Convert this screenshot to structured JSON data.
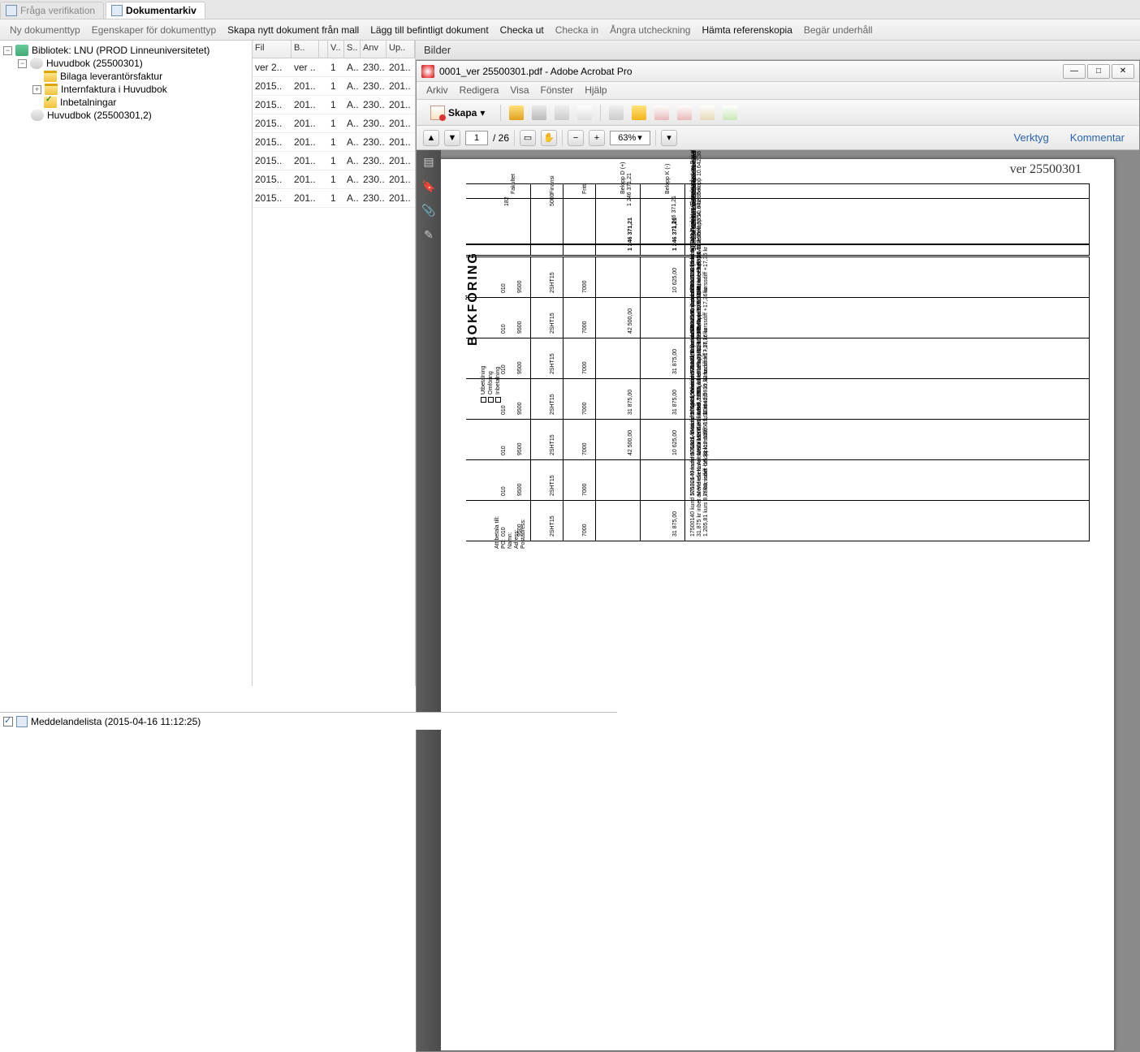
{
  "tabs": [
    {
      "label": "Fråga verifikation",
      "active": false
    },
    {
      "label": "Dokumentarkiv",
      "active": true
    }
  ],
  "toolbar": [
    {
      "label": "Ny dokumenttyp",
      "dark": false
    },
    {
      "label": "Egenskaper för dokumenttyp",
      "dark": false
    },
    {
      "label": "Skapa nytt dokument från mall",
      "dark": true
    },
    {
      "label": "Lägg till befintligt dokument",
      "dark": true
    },
    {
      "label": "Checka ut",
      "dark": true
    },
    {
      "label": "Checka in",
      "dark": false
    },
    {
      "label": "Ångra utcheckning",
      "dark": false
    },
    {
      "label": "Hämta referenskopia",
      "dark": true
    },
    {
      "label": "Begär underhåll",
      "dark": false
    }
  ],
  "tree": {
    "root": "Bibliotek: LNU (PROD Linneuniversitetet)",
    "n1": "Huvudbok (25500301)",
    "n1a": "Bilaga leverantörsfaktur",
    "n1b": "Internfaktura i Huvudbok",
    "n1c": "Inbetalningar",
    "n2": "Huvudbok (25500301,2)"
  },
  "grid": {
    "headers": [
      "Fil",
      "B..",
      "",
      "V..",
      "S..",
      "Anv",
      "Up.."
    ],
    "rows": [
      [
        "ver 2..",
        "ver ..",
        "1",
        "A..",
        "230..",
        "201.."
      ],
      [
        "2015..",
        "201..",
        "1",
        "A..",
        "230..",
        "201.."
      ],
      [
        "2015..",
        "201..",
        "1",
        "A..",
        "230..",
        "201.."
      ],
      [
        "2015..",
        "201..",
        "1",
        "A..",
        "230..",
        "201.."
      ],
      [
        "2015..",
        "201..",
        "1",
        "A..",
        "230..",
        "201.."
      ],
      [
        "2015..",
        "201..",
        "1",
        "A..",
        "230..",
        "201.."
      ],
      [
        "2015..",
        "201..",
        "1",
        "A..",
        "230..",
        "201.."
      ],
      [
        "2015..",
        "201..",
        "1",
        "A..",
        "230..",
        "201.."
      ]
    ]
  },
  "right": {
    "panel_title": "Bilder",
    "doc_title": "0001_ver 25500301.pdf - Adobe Acrobat Pro",
    "menu": [
      "Arkiv",
      "Redigera",
      "Visa",
      "Fönster",
      "Hjälp"
    ],
    "skapa": "Skapa",
    "page": "1",
    "page_of": "/ 26",
    "zoom": "63%",
    "links": [
      "Verktyg",
      "Kommentar"
    ],
    "handwritten": "ver 25500301"
  },
  "doc": {
    "bokforing": "BOKFÖRING",
    "checks": [
      "Utbetalning",
      "Omföring",
      "Inbetalning"
    ],
    "att_betala": "Att betala till:",
    "fields": [
      "PG:",
      "Namn:",
      "Adress:",
      "Postadress:"
    ],
    "hdr": {
      "fak": "Fakultet",
      "fin": "Finansi",
      "fritt": "Fritt",
      "bd": "Belopp D (+)",
      "bk": "Belopp K (-)",
      "txt": "Text i bokföringen"
    },
    "top_rows": [
      {
        "a": "182",
        "b": "5000",
        "d": "1 246 371,21",
        "k": "",
        "t": "Inbetalning 2015-04-13, PG 50916-8"
      },
      {
        "a": "",
        "b": "",
        "d": "",
        "k": "",
        "t": "European Commission, ref 1584005574 PIEF-GA-2013-622888-"
      },
      {
        "a": "",
        "b": "",
        "d": "",
        "k": "1 246 371,21",
        "t": "PROM LNU Dr Jarone Pinhassi Pre-financing, inbet EUR"
      },
      {
        "a": "",
        "b": "",
        "d": "",
        "k": "",
        "t": "134.128,02 kurs 9,29240"
      }
    ],
    "sum": {
      "d": "1 246 371,21",
      "k": "1 246 371,21",
      "t": "Summa Nordea"
    },
    "rows": [
      {
        "a": "010",
        "b": "9500",
        "c": "2SHT15",
        "d": "7000",
        "e": "",
        "k": "10 625,00",
        "t1": "17500150 kund 501323 Bajraktari Flamur, inbet av Bajraktari",
        "t2": "Flamur, EUR 1.140, kurs 9,3354, inbet belopp 10.642,36 kr",
        "t3": "kurssdiff +17,36 kr"
      },
      {
        "a": "010",
        "b": "9500",
        "c": "2SHT15",
        "d": "7000",
        "e": "42 500,00",
        "k": "",
        "t1": "17500150 kund 501323 Bajraktari Flamur, inbet av Bajraktari",
        "t2": "Flamur, EUR 1.140, kurs 9,3354, inbet belopp 10.642,36 kr",
        "t3": "kurssdiff +17,36 kr"
      },
      {
        "a": "010",
        "b": "9500",
        "c": "2SHT15",
        "d": "7000",
        "e": "",
        "k": "31 875,00",
        "t1": "17500150 kund 501323 Bajraktari Flamur, inbet av Bajraktari",
        "t2": "Flamur, EUR 1.140, kurs 9,3354, inbet belopp 10.642,36 kr",
        "t3": "kurssdiff +17,36 kr"
      },
      {
        "a": "010",
        "b": "9500",
        "c": "2SHT15",
        "d": "7000",
        "e": "31 875,00",
        "k": "31 875,00",
        "t1": "17500150 kund 501323 Bajraktari Flamur, stipendium 31.875 kr",
        "t2": "inbet av Bajraktari Flamur, EUR 1.140, kurs 9,3354, inbet belopp",
        "t3": "10.642,36 kr kurssdiff +17,36 kr"
      },
      {
        "a": "010",
        "b": "9500",
        "c": "2SHT15",
        "d": "7000",
        "e": "42 500,00",
        "k": "10 625,00",
        "t1": "17500140 kund 501326 Mendieta Karol, inbet av Mendieta Armando",
        "t2": "Mendieta Karol, USD 1.205,81 kurs 8,7988, inbet belopp 10.609,68",
        "t3": "kr kurssdiff -15,32 kr"
      },
      {
        "a": "010",
        "b": "9500",
        "c": "2SHT15",
        "d": "7000",
        "e": "",
        "k": "",
        "t1": "17500140 kund 501326 Mendieta Karol, inbet av Mendieta Armando",
        "t2": "Mendieta Karol, USD 1.205,81 kurs 8,7988, inbet belopp 10.609,68",
        "t3": "kr kurssdiff -15,32 kr"
      },
      {
        "a": "010",
        "b": "9500",
        "c": "2SHT15",
        "d": "7000",
        "e": "",
        "k": "31 875,00",
        "t1": "17500140 kund 501326 Mendieta Karol, intäktsföring stipendium",
        "t2": "31.875 kr inbet av Mendieta Armando Mendieta Karol, USD",
        "t3": "1.205,81 kurs 8,7988, inbet belopp 10.609,68 kr kurssdiff -15,32 kr"
      }
    ]
  },
  "msgbar": "Meddelandelista (2015-04-16 11:12:25)"
}
